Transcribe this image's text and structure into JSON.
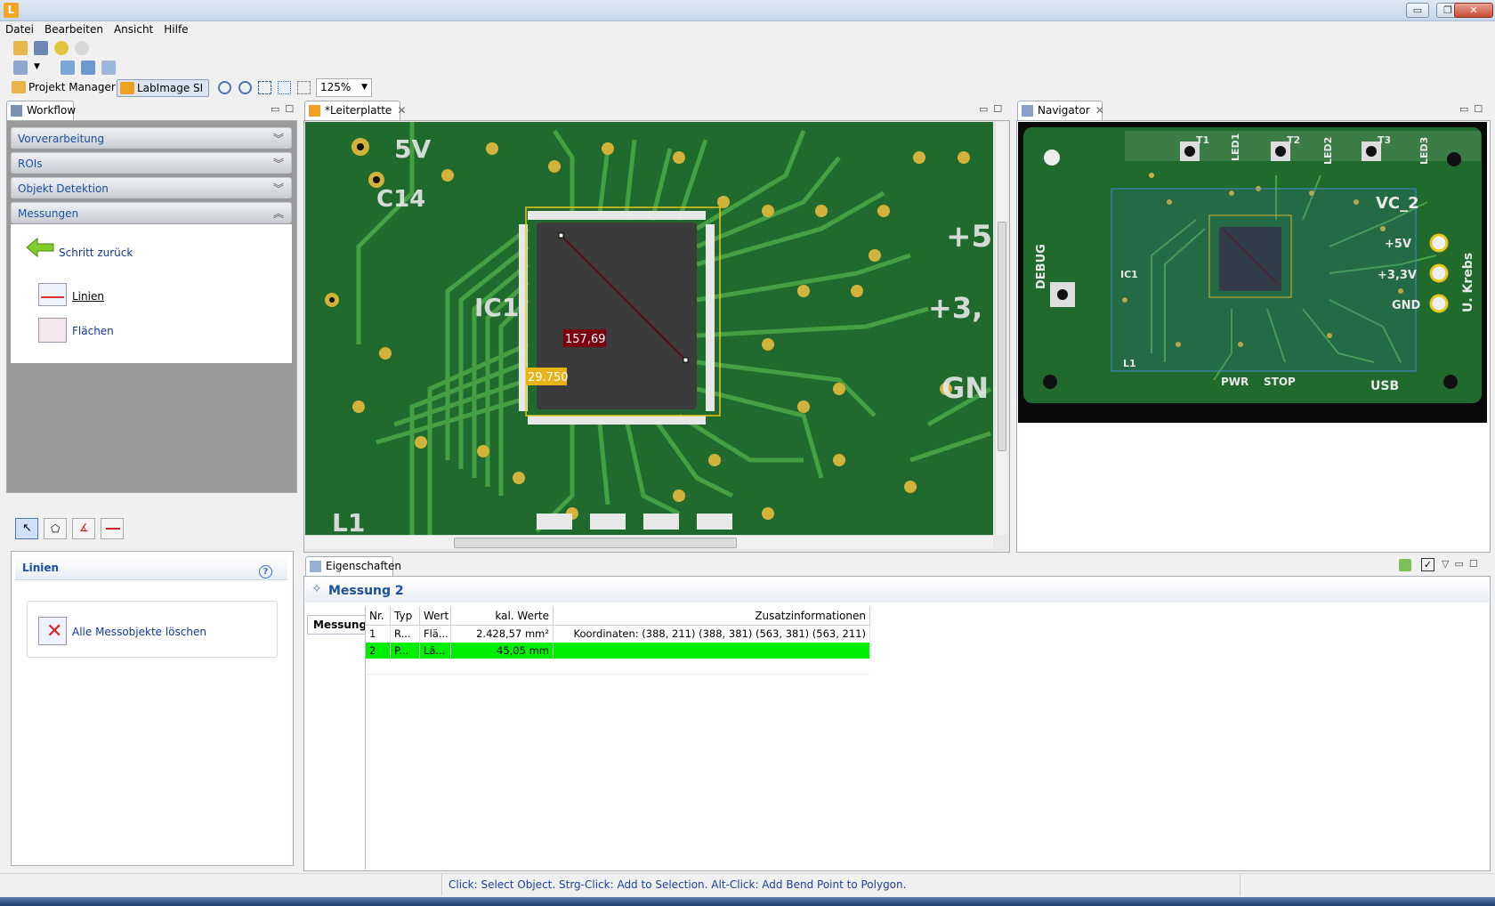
{
  "window": {
    "title": "",
    "minimize": "▭",
    "restore": "❐",
    "close": "✕"
  },
  "menu": [
    "Datei",
    "Bearbeiten",
    "Ansicht",
    "Hilfe"
  ],
  "perspectives": {
    "projekt_manager": "Projekt Manager",
    "labimage": "LabImage SI"
  },
  "zoom": {
    "value": "125%"
  },
  "workflow": {
    "tab": "Workflow",
    "sections": [
      {
        "label": "Vorverarbeitung",
        "expanded": false
      },
      {
        "label": "ROIs",
        "expanded": false
      },
      {
        "label": "Objekt Detektion",
        "expanded": false
      },
      {
        "label": "Messungen",
        "expanded": true
      }
    ],
    "back_label": "Schritt zurück",
    "items": [
      {
        "label": "Linien"
      },
      {
        "label": "Flächen"
      }
    ]
  },
  "tools_panel": {
    "title": "Linien",
    "delete_all": "Alle Messobjekte löschen"
  },
  "editor": {
    "tab": "*Leiterplatte",
    "overlay_length": "157,69",
    "overlay_area": "29.750",
    "board_labels": {
      "ic1": "IC1",
      "v5": "5V",
      "c14": "C14",
      "plus5": "+5",
      "plus33": "+3,",
      "gnd": "GN",
      "l1": "L1"
    }
  },
  "navigator": {
    "tab": "Navigator",
    "labels": {
      "t1": "T1",
      "led1": "LED1",
      "t2": "T2",
      "led2": "LED2",
      "t3": "T3",
      "led3": "LED3",
      "vc2": "VC_2",
      "plus5v": "+5V",
      "plus33v": "+3,3V",
      "gnd": "GND",
      "krebs": "U. Krebs",
      "debug": "DEBUG",
      "ic1": "IC1",
      "l1": "L1",
      "usb": "USB",
      "pwr": "PWR",
      "stop": "STOP"
    }
  },
  "properties": {
    "tab": "Eigenschaften",
    "heading": "Messung 2",
    "side_tab": "Messung",
    "columns": [
      "Nr.",
      "Typ",
      "Wert",
      "kal. Werte",
      "Zusatzinformationen"
    ],
    "rows": [
      {
        "nr": "1",
        "typ": "R...",
        "wert": "Flä...",
        "kal": "2.428,57 mm²",
        "info": "Koordinaten: (388, 211) (388, 381) (563, 381) (563, 211)",
        "selected": false
      },
      {
        "nr": "2",
        "typ": "P...",
        "wert": "Lä...",
        "kal": "45,05 mm",
        "info": "",
        "selected": true
      }
    ]
  },
  "status": {
    "message": "Click: Select Object. Strg-Click: Add to Selection. Alt-Click: Add Bend Point to Polygon."
  },
  "colors": {
    "pcb": "#1f6a2c",
    "trace": "#3f9a3a",
    "accent": "#1b4f9c",
    "selection": "#00ee00",
    "roi": "#e8c61a"
  }
}
